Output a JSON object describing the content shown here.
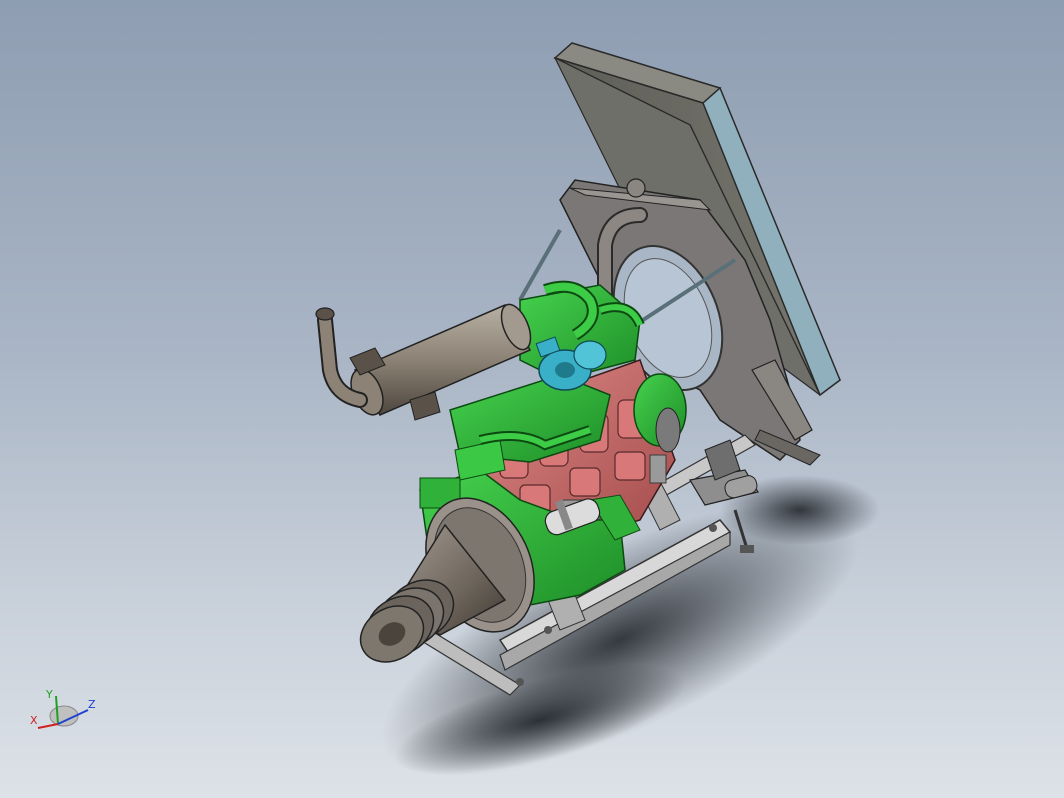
{
  "viewport": {
    "background_top": "#8e9db2",
    "background_bottom": "#dde2e8"
  },
  "model": {
    "engine_block_color": "#c86464",
    "engine_green_color": "#2fbf3a",
    "turbo_color": "#3ab0c8",
    "frame_color": "#c8c8c8",
    "radiator_color": "#6f6f69",
    "muffler_color": "#8c8275"
  },
  "triad": {
    "x_label": "X",
    "y_label": "Y",
    "z_label": "Z",
    "x_color": "#d02020",
    "y_color": "#20a020",
    "z_color": "#2040d0"
  }
}
